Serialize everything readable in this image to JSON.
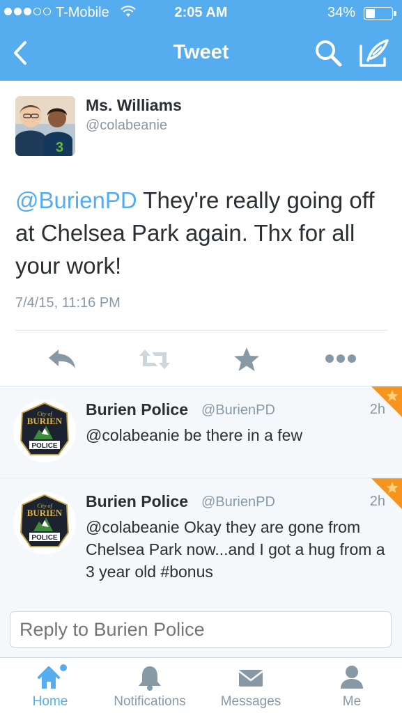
{
  "status_bar": {
    "carrier": "T-Mobile",
    "time": "2:05 AM",
    "battery_percent": "34%",
    "battery_level": 0.34,
    "signal_bars_filled": 3,
    "signal_bars_total": 5
  },
  "nav": {
    "title": "Tweet",
    "back_icon": "chevron-left-icon",
    "search_icon": "search-icon",
    "compose_icon": "compose-icon"
  },
  "tweet": {
    "author_name": "Ms. Williams",
    "author_handle": "@colabeanie",
    "mention": "@BurienPD",
    "text": " They're really going off at Chelsea Park again. Thx for all your work!",
    "timestamp": "7/4/15, 11:16 PM"
  },
  "actions": {
    "reply_icon": "reply-icon",
    "retweet_icon": "retweet-icon",
    "favorite_icon": "star-icon",
    "more_icon": "more-icon"
  },
  "replies": [
    {
      "name": "Burien Police",
      "handle": "@BurienPD",
      "time": "2h",
      "text": "@colabeanie be there in a few",
      "badge": {
        "top": "City of",
        "middle": "BURIEN",
        "bottom": "POLICE"
      }
    },
    {
      "name": "Burien Police",
      "handle": "@BurienPD",
      "time": "2h",
      "text": "@colabeanie Okay they are gone from Chelsea Park now...and I got a hug from a 3 year old #bonus",
      "badge": {
        "top": "City of",
        "middle": "BURIEN",
        "bottom": "POLICE"
      }
    }
  ],
  "reply_box": {
    "placeholder": "Reply to Burien Police"
  },
  "tabs": [
    {
      "label": "Home",
      "icon": "home-icon",
      "active": true
    },
    {
      "label": "Notifications",
      "icon": "bell-icon",
      "active": false
    },
    {
      "label": "Messages",
      "icon": "envelope-icon",
      "active": false
    },
    {
      "label": "Me",
      "icon": "person-icon",
      "active": false
    }
  ],
  "colors": {
    "brand": "#55acee",
    "text": "#292f33",
    "muted": "#8899a6",
    "favorite_corner": "#f7941e"
  }
}
